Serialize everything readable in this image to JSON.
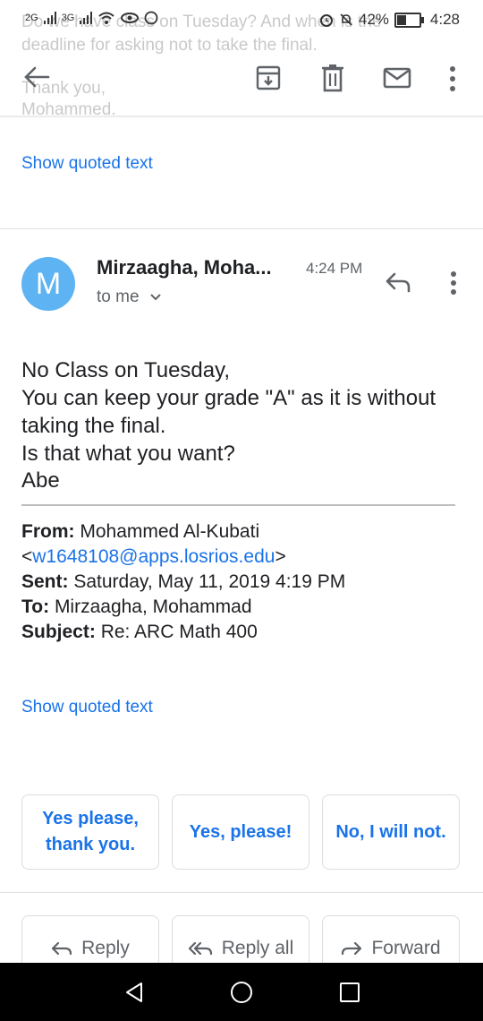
{
  "background_text": {
    "line1": "Do we have class on Tuesday? And when is the",
    "line2": "deadline for asking not to take the final.",
    "line3": "Thank you,",
    "line4": "Mohammed."
  },
  "status_bar": {
    "network_left": "2G",
    "network_right": "3G",
    "battery": "42%",
    "time": "4:28"
  },
  "quoted_top": {
    "label": "Show quoted text"
  },
  "message": {
    "avatar_letter": "M",
    "sender": "Mirzaagha, Moha...",
    "time": "4:24 PM",
    "recipient": "to me",
    "body": [
      "No Class on Tuesday,",
      "You can keep your grade \"A\" as it is without",
      "taking the final.",
      "Is that what you want?",
      "Abe"
    ],
    "quoted_header": {
      "from_label": "From:",
      "from_value": "Mohammed Al-Kubati",
      "email_open": "<",
      "email": "w1648108@apps.losrios.edu",
      "email_close": ">",
      "sent_label": "Sent:",
      "sent_value": "Saturday, May 11, 2019 4:19 PM",
      "to_label": "To:",
      "to_value": "Mirzaagha, Mohammad",
      "subject_label": "Subject:",
      "subject_value": "Re: ARC Math 400"
    }
  },
  "quoted_bottom": {
    "label": "Show quoted text"
  },
  "smart_replies": {
    "reply1_line1": "Yes please,",
    "reply1_line2": "thank you.",
    "reply2": "Yes, please!",
    "reply3": "No, I will not."
  },
  "actions": {
    "reply": "Reply",
    "reply_all": "Reply all",
    "forward": "Forward"
  },
  "colors": {
    "accent": "#1a73e8",
    "avatar": "#5eb3f2"
  }
}
